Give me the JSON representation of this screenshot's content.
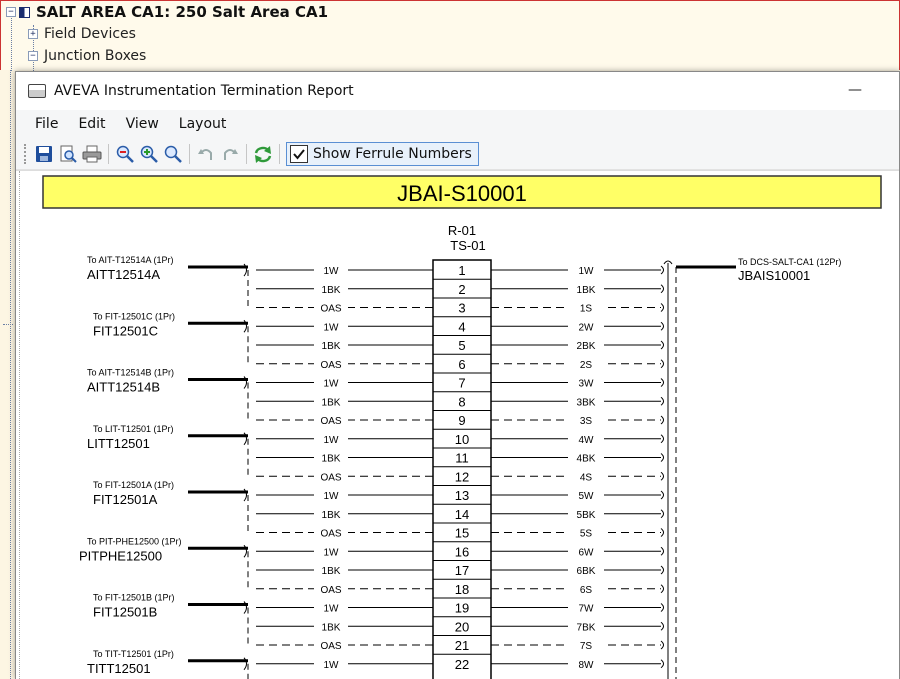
{
  "tree": {
    "area_label": "SALT AREA CA1: 250 Salt Area CA1",
    "children": [
      "Field Devices",
      "Junction Boxes"
    ],
    "expander_collapsed": "+",
    "expander_expanded": "−"
  },
  "window": {
    "title": "AVEVA Instrumentation Termination Report",
    "minimize_symbol": "—"
  },
  "menu": [
    "File",
    "Edit",
    "View",
    "Layout"
  ],
  "toolbar": {
    "buttons": [
      "save-icon",
      "print-preview-icon",
      "print-icon",
      "zoom-out-icon",
      "zoom-in-icon",
      "zoom-fit-icon",
      "undo-icon",
      "redo-icon",
      "refresh-icon"
    ],
    "ferrule_label": "Show Ferrule Numbers",
    "ferrule_checked": true
  },
  "report": {
    "junction_box": "JBAI-S10001",
    "rack": "R-01",
    "terminal_strip": "TS-01",
    "colors": {
      "header_fill": "#ffff66",
      "line": "#000000"
    },
    "outgoing": {
      "to": "To DCS-SALT-CA1 (12Pr)",
      "cable": "JBAIS10001"
    },
    "incoming": [
      {
        "to": "To AIT-T12514A (1Pr)",
        "tag": "AITT12514A"
      },
      {
        "to": "To FIT-12501C (1Pr)",
        "tag": "FIT12501C"
      },
      {
        "to": "To AIT-T12514B (1Pr)",
        "tag": "AITT12514B"
      },
      {
        "to": "To LIT-T12501 (1Pr)",
        "tag": "LITT12501"
      },
      {
        "to": "To FIT-12501A (1Pr)",
        "tag": "FIT12501A"
      },
      {
        "to": "To PIT-PHE12500 (1Pr)",
        "tag": "PITPHE12500"
      },
      {
        "to": "To FIT-12501B (1Pr)",
        "tag": "FIT12501B"
      },
      {
        "to": "To TIT-T12501 (1Pr)",
        "tag": "TITT12501"
      }
    ],
    "terminals": [
      {
        "num": "1",
        "left": "1W",
        "right": "1W"
      },
      {
        "num": "2",
        "left": "1BK",
        "right": "1BK"
      },
      {
        "num": "3",
        "left": "OAS",
        "right": "1S"
      },
      {
        "num": "4",
        "left": "1W",
        "right": "2W"
      },
      {
        "num": "5",
        "left": "1BK",
        "right": "2BK"
      },
      {
        "num": "6",
        "left": "OAS",
        "right": "2S"
      },
      {
        "num": "7",
        "left": "1W",
        "right": "3W"
      },
      {
        "num": "8",
        "left": "1BK",
        "right": "3BK"
      },
      {
        "num": "9",
        "left": "OAS",
        "right": "3S"
      },
      {
        "num": "10",
        "left": "1W",
        "right": "4W"
      },
      {
        "num": "11",
        "left": "1BK",
        "right": "4BK"
      },
      {
        "num": "12",
        "left": "OAS",
        "right": "4S"
      },
      {
        "num": "13",
        "left": "1W",
        "right": "5W"
      },
      {
        "num": "14",
        "left": "1BK",
        "right": "5BK"
      },
      {
        "num": "15",
        "left": "OAS",
        "right": "5S"
      },
      {
        "num": "16",
        "left": "1W",
        "right": "6W"
      },
      {
        "num": "17",
        "left": "1BK",
        "right": "6BK"
      },
      {
        "num": "18",
        "left": "OAS",
        "right": "6S"
      },
      {
        "num": "19",
        "left": "1W",
        "right": "7W"
      },
      {
        "num": "20",
        "left": "1BK",
        "right": "7BK"
      },
      {
        "num": "21",
        "left": "OAS",
        "right": "7S"
      },
      {
        "num": "22",
        "left": "1W",
        "right": "8W"
      }
    ]
  }
}
